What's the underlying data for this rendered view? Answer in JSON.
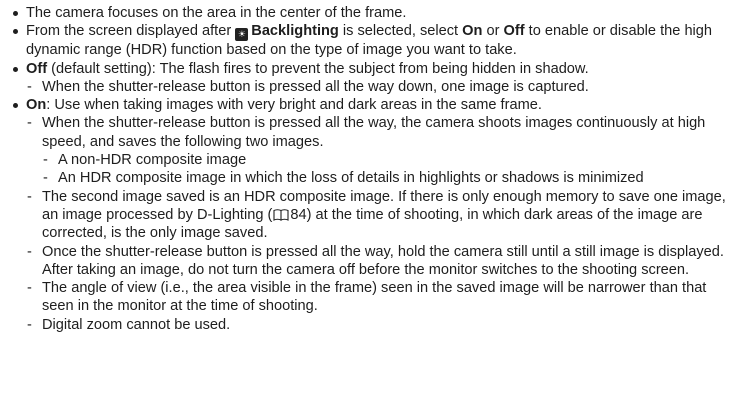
{
  "items": [
    {
      "t": "The camera focuses on the area in the center of the frame."
    },
    {
      "pre": "From the screen displayed after ",
      "bold1": "Backlighting",
      "mid1": " is selected, select ",
      "bold2": "On",
      "mid2": " or ",
      "bold3": "Off",
      "post": " to enable or disable the high dynamic range (HDR) function based on the type of image you want to take."
    },
    {
      "bold": "Off",
      "rest": " (default setting): The flash fires to prevent the subject from being hidden in shadow."
    },
    {
      "t": "When the shutter-release button is pressed all the way down, one image is captured."
    },
    {
      "bold": "On",
      "rest": ": Use when taking images with very bright and dark areas in the same frame."
    },
    {
      "t": "When the shutter-release button is pressed all the way, the camera shoots images continuously at high speed, and saves the following two images."
    },
    {
      "t": "A non-HDR composite image"
    },
    {
      "t": "An HDR composite image in which the loss of details in highlights or shadows is minimized"
    },
    {
      "pre": "The second image saved is an HDR composite image. If there is only enough memory to save one image, an image processed by D-Lighting (",
      "ref": "84",
      "post": ") at the time of shooting, in which dark areas of the image are corrected, is the only image saved."
    },
    {
      "t": "Once the shutter-release button is pressed all the way, hold the camera still until a still image is displayed. After taking an image, do not turn the camera off before the monitor switches to the shooting screen."
    },
    {
      "t": "The angle of view (i.e., the area visible in the frame) seen in the saved image will be narrower than that seen in the monitor at the time of shooting."
    },
    {
      "t": "Digital zoom cannot be used."
    }
  ],
  "icons": {
    "scene": "backlighting-scene-icon",
    "reference": "book-reference-icon"
  }
}
